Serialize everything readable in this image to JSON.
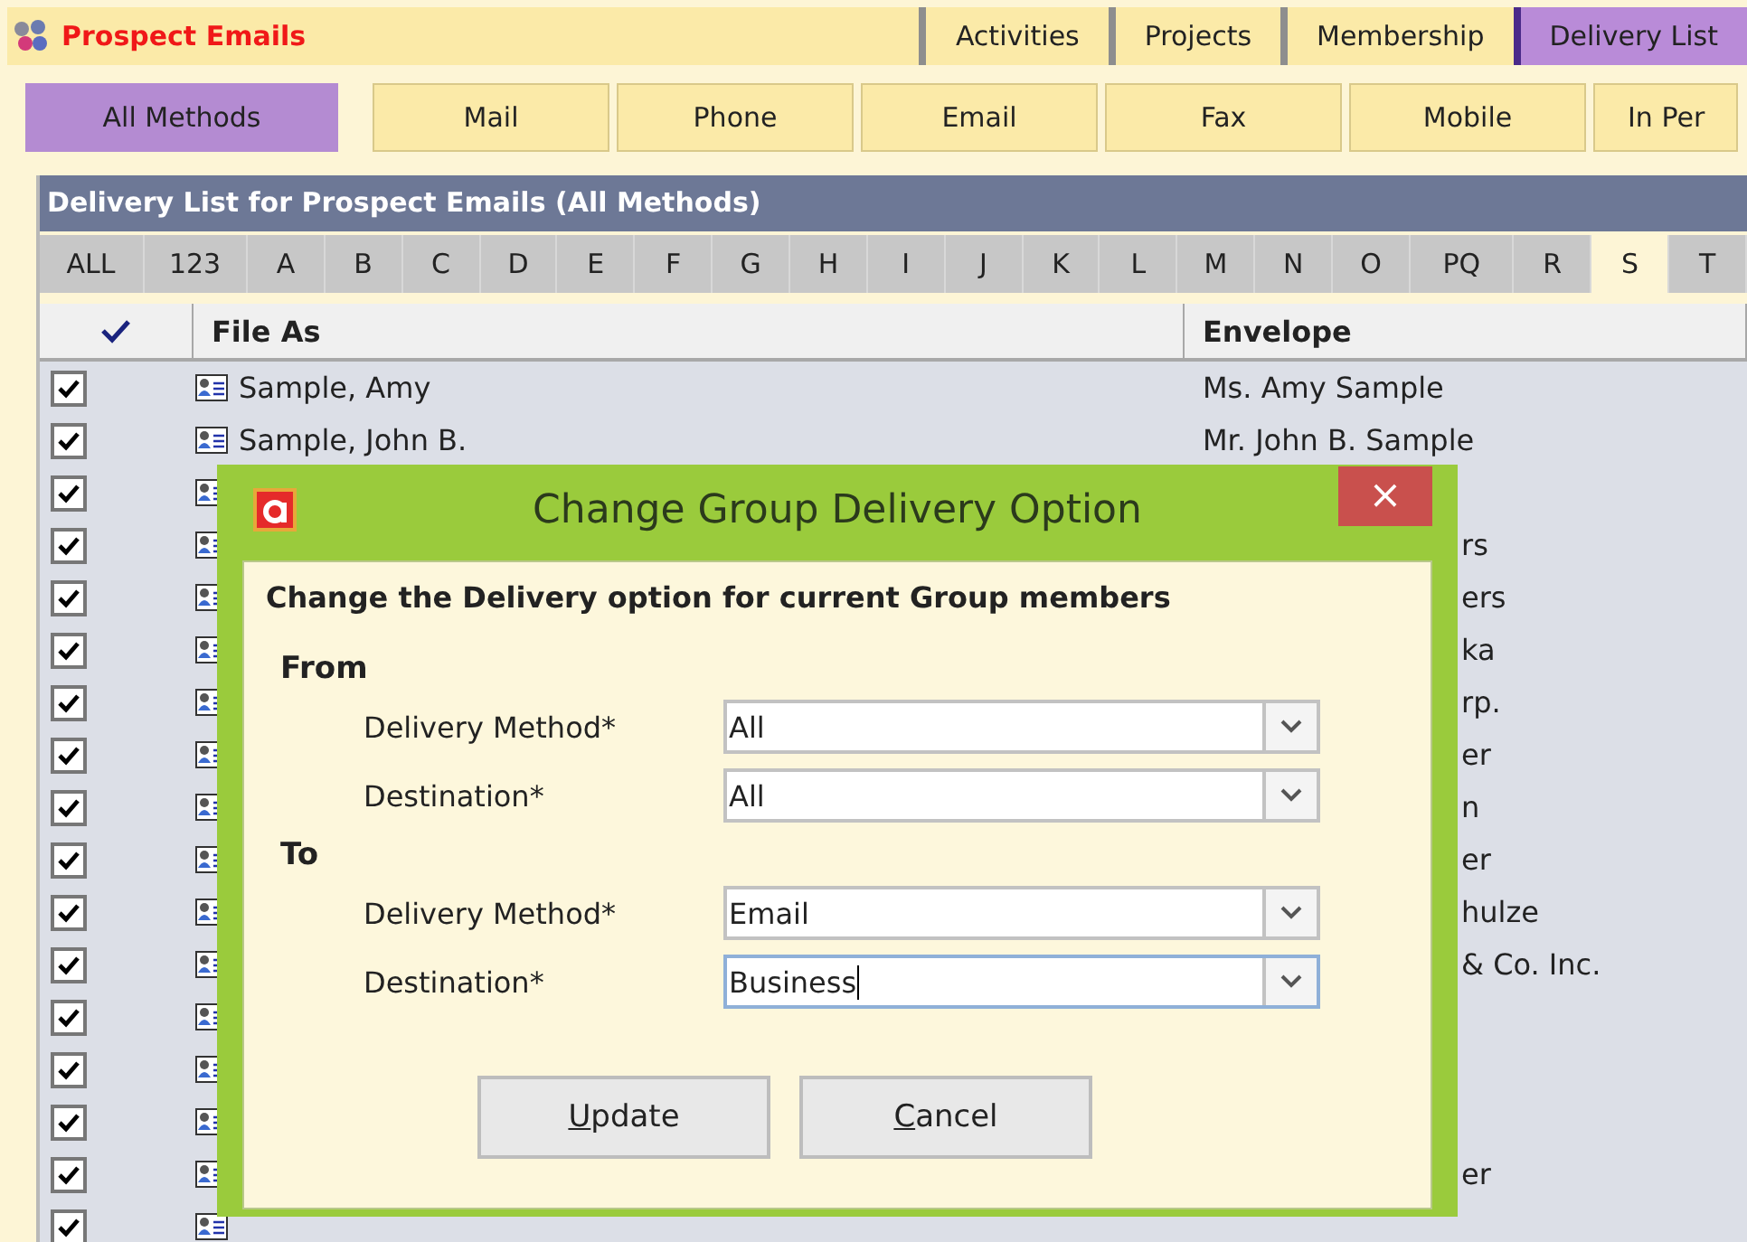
{
  "app_title": "Prospect Emails",
  "top_tabs": [
    {
      "label": "Activities",
      "selected": false
    },
    {
      "label": "Projects",
      "selected": false
    },
    {
      "label": "Membership",
      "selected": false
    },
    {
      "label": "Delivery List",
      "selected": true
    }
  ],
  "method_tabs": [
    {
      "label": "All Methods",
      "selected": true
    },
    {
      "label": "Mail",
      "selected": false
    },
    {
      "label": "Phone",
      "selected": false
    },
    {
      "label": "Email",
      "selected": false
    },
    {
      "label": "Fax",
      "selected": false
    },
    {
      "label": "Mobile",
      "selected": false
    },
    {
      "label": "In Per",
      "selected": false
    }
  ],
  "list_title": "Delivery List for Prospect Emails (All Methods)",
  "letters": [
    {
      "label": "ALL",
      "selected": false
    },
    {
      "label": "123",
      "selected": false
    },
    {
      "label": "A",
      "selected": false
    },
    {
      "label": "B",
      "selected": false
    },
    {
      "label": "C",
      "selected": false
    },
    {
      "label": "D",
      "selected": false
    },
    {
      "label": "E",
      "selected": false
    },
    {
      "label": "F",
      "selected": false
    },
    {
      "label": "G",
      "selected": false
    },
    {
      "label": "H",
      "selected": false
    },
    {
      "label": "I",
      "selected": false
    },
    {
      "label": "J",
      "selected": false
    },
    {
      "label": "K",
      "selected": false
    },
    {
      "label": "L",
      "selected": false
    },
    {
      "label": "M",
      "selected": false
    },
    {
      "label": "N",
      "selected": false
    },
    {
      "label": "O",
      "selected": false
    },
    {
      "label": "PQ",
      "selected": false
    },
    {
      "label": "R",
      "selected": false
    },
    {
      "label": "S",
      "selected": true
    },
    {
      "label": "T",
      "selected": false
    }
  ],
  "columns": [
    "File As",
    "Envelope"
  ],
  "rows": [
    {
      "checked": true,
      "file_as": "Sample, Amy",
      "envelope": "Ms. Amy Sample"
    },
    {
      "checked": true,
      "file_as": "Sample, John B.",
      "envelope": "Mr. John B. Sample"
    },
    {
      "checked": true
    },
    {
      "checked": true,
      "envelope": "rs"
    },
    {
      "checked": true,
      "envelope": "ers"
    },
    {
      "checked": true,
      "envelope": "ka"
    },
    {
      "checked": true,
      "envelope": "rp."
    },
    {
      "checked": true,
      "envelope": "er"
    },
    {
      "checked": true,
      "envelope": "n"
    },
    {
      "checked": true,
      "envelope": "er"
    },
    {
      "checked": true,
      "envelope": "hulze"
    },
    {
      "checked": true,
      "envelope": "& Co. Inc."
    },
    {
      "checked": true
    },
    {
      "checked": true
    },
    {
      "checked": true
    },
    {
      "checked": true,
      "envelope": "er"
    },
    {
      "checked": true
    }
  ],
  "dialog": {
    "title": "Change Group Delivery Option",
    "close": "×",
    "heading": "Change the Delivery option for current Group members",
    "sections": [
      {
        "label": "From",
        "fields": [
          {
            "label": "Delivery Method*",
            "value": "All",
            "focused": false
          },
          {
            "label": "Destination*",
            "value": "All",
            "focused": false
          }
        ]
      },
      {
        "label": "To",
        "fields": [
          {
            "label": "Delivery Method*",
            "value": "Email",
            "focused": false
          },
          {
            "label": "Destination*",
            "value": "Business",
            "focused": true
          }
        ]
      }
    ],
    "buttons": [
      {
        "mnemonic": "U",
        "rest": "pdate"
      },
      {
        "mnemonic": "C",
        "rest": "ancel"
      }
    ]
  }
}
